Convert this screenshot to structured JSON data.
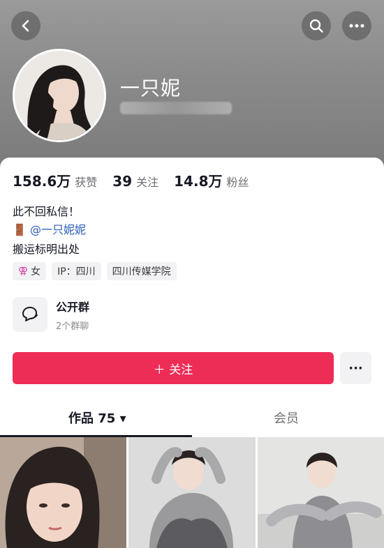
{
  "profile": {
    "name": "一只妮",
    "stats": [
      {
        "value": "158.6万",
        "label": "获赞"
      },
      {
        "value": "39",
        "label": "关注"
      },
      {
        "value": "14.8万",
        "label": "粉丝"
      }
    ],
    "bio": {
      "line1": "此不回私信！",
      "line2_emoji": "🚪",
      "line2_mention": "@一只妮妮",
      "line3": "搬运标明出处"
    },
    "tags": {
      "gender_symbol": "⚢",
      "gender": "女",
      "ip": "IP：四川",
      "school": "四川传媒学院"
    },
    "group": {
      "title": "公开群",
      "subtitle": "2个群聊"
    }
  },
  "actions": {
    "follow_label": "＋ 关注",
    "more_glyph": "···"
  },
  "tabs": {
    "works": "作品 75 ▾",
    "member": "会员"
  },
  "colors": {
    "accent": "#ee2d57",
    "header": "#8a8a8a",
    "mention": "#2a5bb8"
  },
  "icons": {
    "back": "back-icon",
    "search": "search-icon",
    "more": "more-icon",
    "group": "chat-bubbles-icon"
  }
}
